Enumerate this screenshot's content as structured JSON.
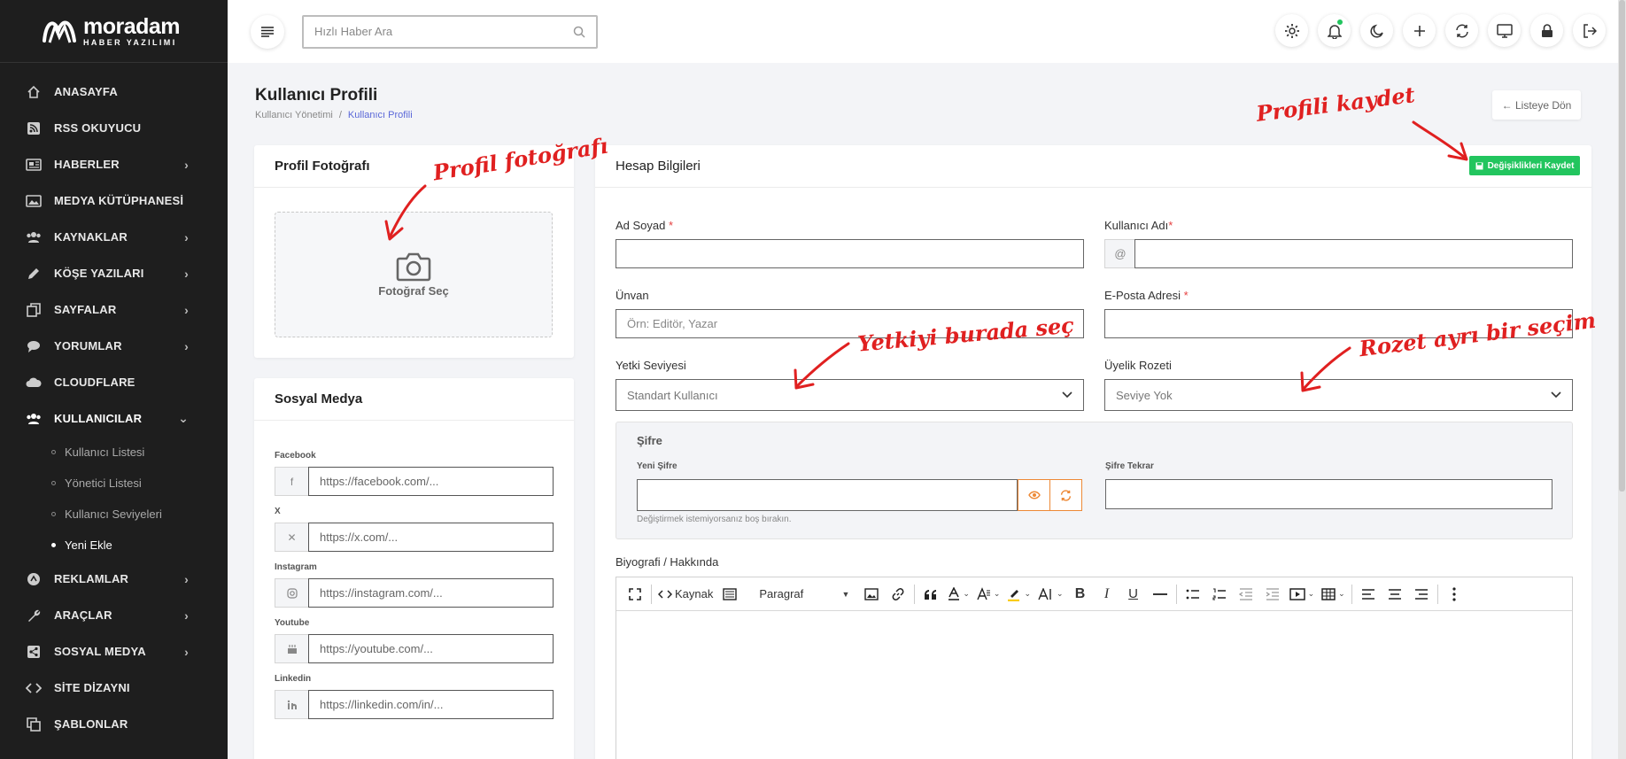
{
  "brand": {
    "name": "moradam",
    "tagline": "HABER YAZILIMI"
  },
  "topbar": {
    "search_placeholder": "Hızlı Haber Ara",
    "icons": [
      "gear-icon",
      "bell-icon",
      "moon-icon",
      "plus-icon",
      "refresh-icon",
      "monitor-icon",
      "lock-icon",
      "logout-icon"
    ]
  },
  "sidebar": {
    "items": [
      {
        "label": "ANASAYFA",
        "icon": "home-icon",
        "chevron": false
      },
      {
        "label": "RSS OKUYUCU",
        "icon": "rss-icon",
        "chevron": false
      },
      {
        "label": "HABERLER",
        "icon": "newspaper-icon",
        "chevron": true
      },
      {
        "label": "MEDYA KÜTÜPHANESİ",
        "icon": "image-icon",
        "chevron": false
      },
      {
        "label": "KAYNAKLAR",
        "icon": "users-icon",
        "chevron": true
      },
      {
        "label": "KÖŞE YAZILARI",
        "icon": "pen-icon",
        "chevron": true
      },
      {
        "label": "SAYFALAR",
        "icon": "pages-icon",
        "chevron": true
      },
      {
        "label": "YORUMLAR",
        "icon": "comment-icon",
        "chevron": true
      },
      {
        "label": "CLOUDFLARE",
        "icon": "cloud-icon",
        "chevron": false
      },
      {
        "label": "KULLANICILAR",
        "icon": "users-icon",
        "chevron": true
      }
    ],
    "sub_items": [
      "Kullanıcı Listesi",
      "Yönetici Listesi",
      "Kullanıcı Seviyeleri",
      "Yeni Ekle"
    ],
    "items_after": [
      {
        "label": "REKLAMLAR",
        "icon": "ads-icon",
        "chevron": true
      },
      {
        "label": "ARAÇLAR",
        "icon": "wrench-icon",
        "chevron": true
      },
      {
        "label": "SOSYAL MEDYA",
        "icon": "share-icon",
        "chevron": true
      },
      {
        "label": "SİTE DİZAYNI",
        "icon": "code-icon",
        "chevron": false
      },
      {
        "label": "ŞABLONLAR",
        "icon": "copy-icon",
        "chevron": false
      }
    ]
  },
  "page": {
    "title": "Kullanıcı Profili",
    "breadcrumb": [
      "Kullanıcı Yönetimi",
      "/",
      "Kullanıcı Profili"
    ],
    "back_label": "← Listeye Dön"
  },
  "photo_card": {
    "title": "Profil Fotoğrafı",
    "select_label": "Fotoğraf Seç"
  },
  "social_card": {
    "title": "Sosyal Medya",
    "fields": [
      {
        "label": "Facebook",
        "placeholder": "https://facebook.com/...",
        "icon": "facebook-icon"
      },
      {
        "label": "X",
        "placeholder": "https://x.com/...",
        "icon": "x-icon"
      },
      {
        "label": "Instagram",
        "placeholder": "https://instagram.com/...",
        "icon": "instagram-icon"
      },
      {
        "label": "Youtube",
        "placeholder": "https://youtube.com/...",
        "icon": "youtube-icon"
      },
      {
        "label": "Linkedin",
        "placeholder": "https://linkedin.com/in/...",
        "icon": "linkedin-icon"
      }
    ]
  },
  "account_card": {
    "title": "Hesap Bilgileri",
    "save_label": "Değişiklikleri Kaydet",
    "fullname_label": "Ad Soyad",
    "username_label": "Kullanıcı Adı",
    "at_sign": "@",
    "title_label": "Ünvan",
    "title_placeholder": "Örn: Editör, Yazar",
    "email_label": "E-Posta Adresi",
    "role_label": "Yetki Seviyesi",
    "role_value": "Standart Kullanıcı",
    "badge_label": "Üyelik Rozeti",
    "badge_value": "Seviye Yok",
    "required_mark": "*",
    "password": {
      "title": "Şifre",
      "new_label": "Yeni Şifre",
      "repeat_label": "Şifre Tekrar",
      "hint": "Değiştirmek istemiyorsanız boş bırakın."
    },
    "bio_label": "Biyografi / Hakkında",
    "editor": {
      "source_label": "Kaynak",
      "paragraph_label": "Paragraf"
    }
  },
  "annotations": {
    "photo": "Profil fotoğrafı",
    "save": "Profili kaydet",
    "role": "Yetkiyi burada seç",
    "badge": "Rozet ayrı bir seçim"
  },
  "colors": {
    "sidebar_bg": "#1e1e1e",
    "accent": "#5a67d8",
    "save": "#22c55e",
    "annotation": "#e02020",
    "password_btn": "#ed8936"
  }
}
